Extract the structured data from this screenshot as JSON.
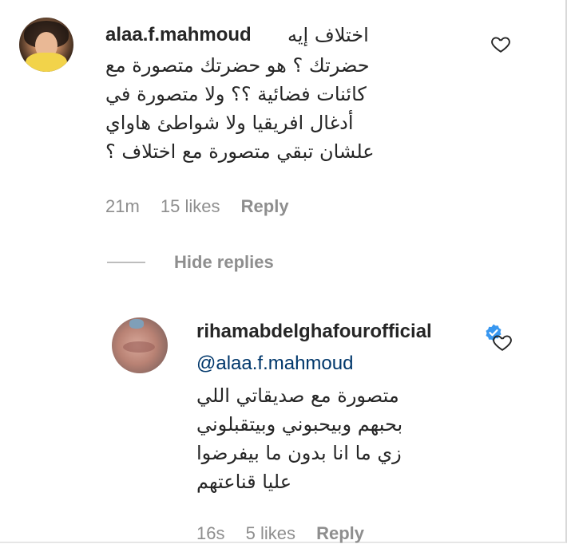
{
  "comments": [
    {
      "username": "alaa.f.mahmoud",
      "inline_text": "اختلاف إيه",
      "body_lines": [
        "حضرتك ؟ هو حضرتك متصورة مع",
        "كائنات فضائية ؟؟ ولا متصورة في",
        "أدغال افريقيا ولا شواطئ هاواي",
        "علشان تبقي متصورة مع اختلاف ؟"
      ],
      "time": "21m",
      "likes": "15 likes",
      "reply_label": "Reply",
      "like_icon": "heart-outline-icon"
    }
  ],
  "hide_replies_label": "Hide replies",
  "replies": [
    {
      "username": "rihamabdelghafourofficial",
      "verified": true,
      "verified_icon": "verified-badge-icon",
      "verified_color": "#3897f0",
      "mention": "@alaa.f.mahmoud",
      "body_lines": [
        "متصورة مع صديقاتي اللي",
        "بحبهم وبيحبوني وبيتقبلوني",
        "زي ما انا بدون ما بيفرضوا",
        "عليا قناعتهم"
      ],
      "time": "16s",
      "likes": "5 likes",
      "reply_label": "Reply",
      "like_icon": "heart-outline-icon"
    }
  ],
  "colors": {
    "text": "#262626",
    "secondary": "#8e8e8e",
    "mention": "#00376b"
  }
}
